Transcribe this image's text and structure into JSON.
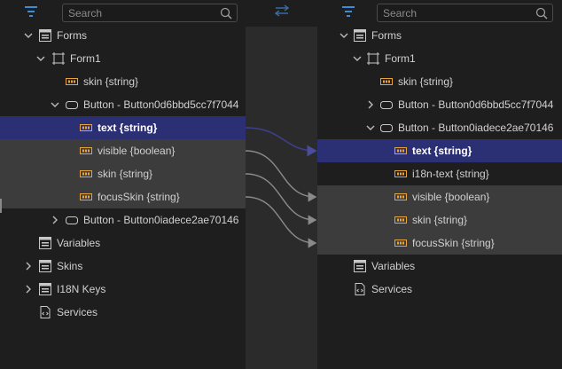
{
  "search": {
    "placeholder": "Search"
  },
  "left_tree": {
    "forms": "Forms",
    "form1": "Form1",
    "skin_string": "skin {string}",
    "button1": "Button - Button0d6bbd5cc7f7044",
    "text_string": "text {string}",
    "visible_boolean": "visible {boolean}",
    "skin_string_2": "skin {string}",
    "focusskin_string": "focusSkin {string}",
    "button2": "Button - Button0iadece2ae70146",
    "variables": "Variables",
    "skins": "Skins",
    "i18n_keys": "I18N Keys",
    "services": "Services"
  },
  "right_tree": {
    "forms": "Forms",
    "form1": "Form1",
    "skin_string": "skin {string}",
    "button1": "Button - Button0d6bbd5cc7f7044",
    "button2": "Button - Button0iadece2ae70146",
    "text_string": "text {string}",
    "i18n_text_string": "i18n-text {string}",
    "visible_boolean": "visible {boolean}",
    "skin_string_2": "skin {string}",
    "focusskin_string": "focusSkin {string}",
    "variables": "Variables",
    "services": "Services"
  },
  "colors": {
    "background": "#1e1e1e",
    "gutter": "#2b2b2b",
    "selected_row": "#2b2f74",
    "mapped_row": "#3c3c3c",
    "accent_blue": "#3b8bd6",
    "property_icon": "#e8a33a",
    "connector_selected": "#3d3f8f",
    "connector": "#8a8a8a"
  },
  "icons": [
    "filter-icon",
    "search-icon",
    "swap-icon",
    "chevron-down-icon",
    "chevron-right-icon",
    "form-icon",
    "frame-icon",
    "button-widget-icon",
    "property-icon",
    "variables-icon",
    "services-icon"
  ]
}
